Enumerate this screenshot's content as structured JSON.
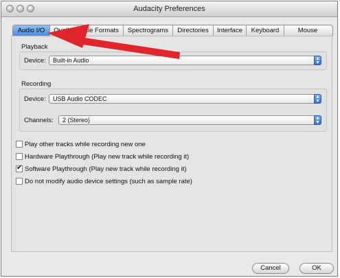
{
  "window": {
    "title": "Audacity Preferences"
  },
  "tabs": [
    {
      "label": "Audio I/O",
      "active": true
    },
    {
      "label": "Quality",
      "active": false
    },
    {
      "label": "File Formats",
      "active": false
    },
    {
      "label": "Spectrograms",
      "active": false
    },
    {
      "label": "Directories",
      "active": false
    },
    {
      "label": "Interface",
      "active": false
    },
    {
      "label": "Keyboard",
      "active": false
    },
    {
      "label": "Mouse",
      "active": false
    }
  ],
  "playback": {
    "heading": "Playback",
    "device_label": "Device:",
    "device_value": "Built-in Audio"
  },
  "recording": {
    "heading": "Recording",
    "device_label": "Device:",
    "device_value": "USB Audio CODEC",
    "channels_label": "Channels:",
    "channels_value": "2 (Stereo)"
  },
  "options": [
    {
      "label": "Play other tracks while recording new one",
      "checked": false
    },
    {
      "label": "Hardware Playthrough (Play new track while recording it)",
      "checked": false
    },
    {
      "label": "Software Playthrough (Play new track while recording it)",
      "checked": true
    },
    {
      "label": "Do not modify audio device settings (such as sample rate)",
      "checked": false
    }
  ],
  "buttons": {
    "cancel": "Cancel",
    "ok": "OK"
  },
  "annotation": {
    "arrow_color": "#e0262a",
    "icon": "red-arrow-icon"
  },
  "colors": {
    "active_tab": "#3f86dc",
    "popup_arrow": "#2f6fd0"
  }
}
